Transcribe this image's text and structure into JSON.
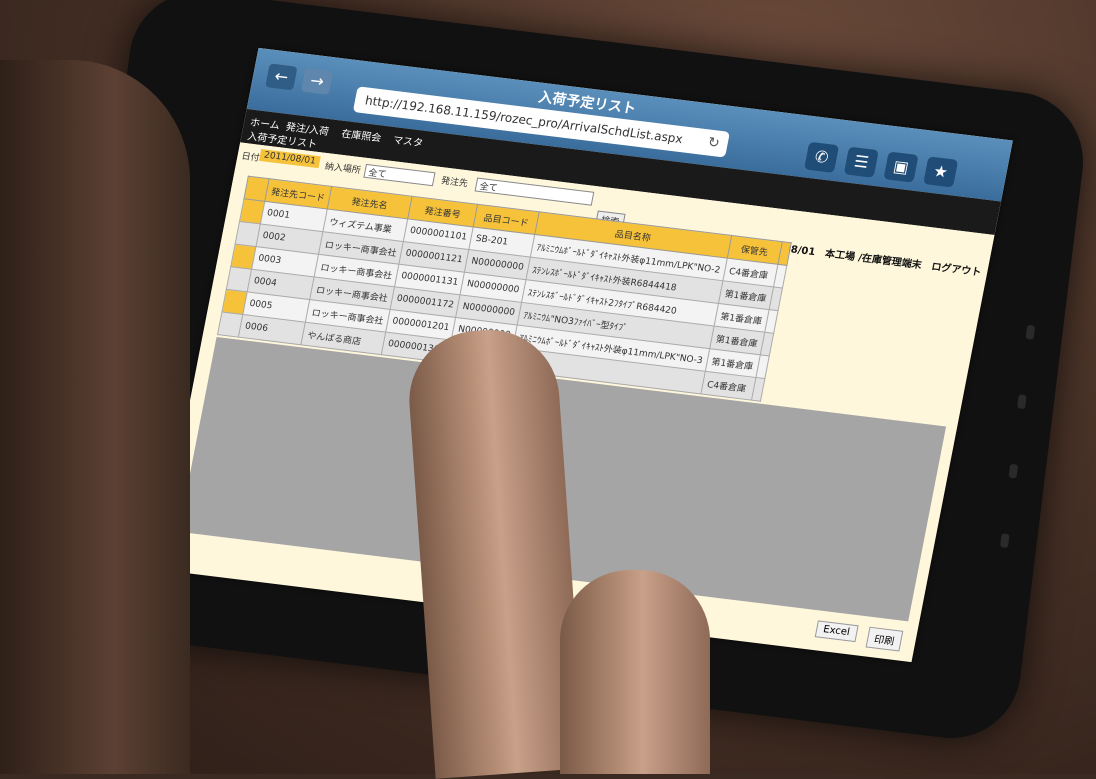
{
  "browser": {
    "title": "入荷予定リスト",
    "url": "http://192.168.11.159/rozec_pro/ArrivalSchdList.aspx",
    "back_icon": "←",
    "forward_icon": "→",
    "refresh_icon": "↻"
  },
  "toolbar": {
    "phone_icon": "✆",
    "memo_icon": "☰",
    "window_icon": "▣",
    "favorite_icon": "★"
  },
  "menu": {
    "items": [
      "ホーム",
      "発注/入荷",
      "在庫照会",
      "マスタ"
    ],
    "current": "入荷予定リスト"
  },
  "filters": {
    "date_label": "日付",
    "date_value": "2011/08/01",
    "warehouse_label": "納入場所",
    "warehouse_value": "全て",
    "supplier_label": "発注先",
    "supplier_value": "全て",
    "search_button": "検索"
  },
  "status": {
    "user_info": "2011/08/01　本工場 /在庫管理端末　ログアウト"
  },
  "table": {
    "headers": [
      "",
      "発注先コード",
      "発注先名",
      "発注番号",
      "品目コード",
      "品目名称",
      "保管先",
      ""
    ],
    "rows": [
      [
        "",
        "0001",
        "ウィズテム事業",
        "0000001101",
        "SB-201",
        "ｱﾙﾐﾆｳﾑﾎﾞｰﾙﾄﾞﾀﾞｲｷｬｽﾄ外装φ11mm/LPK\"NO-2",
        "C4番倉庫"
      ],
      [
        "",
        "0002",
        "ロッキー商事会社",
        "0000001121",
        "N00000000",
        "ｽﾃﾝﾚｽﾎﾞｰﾙﾄﾞﾀﾞｲｷｬｽﾄ外装R6844418",
        "第1番倉庫"
      ],
      [
        "",
        "0003",
        "ロッキー商事会社",
        "0000001131",
        "N00000000",
        "ｽﾃﾝﾚｽﾎﾞｰﾙﾄﾞﾀﾞｲｷｬｽﾄ2ﾌﾀｲﾌﾟR684420",
        "第1番倉庫"
      ],
      [
        "",
        "0004",
        "ロッキー商事会社",
        "0000001172",
        "N00000000",
        "ｱﾙﾐﾆｳﾑ\"NO3ﾌｧｲﾊﾞｰ型ﾀｲﾌﾟ",
        "第1番倉庫"
      ],
      [
        "",
        "0005",
        "ロッキー商事会社",
        "0000001201",
        "N00000000",
        "ｱﾙﾐﾆｳﾑﾎﾞｰﾙﾄﾞﾀﾞｲｷｬｽﾄ外装φ11mm/LPK\"NO-3",
        "第1番倉庫"
      ],
      [
        "",
        "0006",
        "やんばる商店",
        "0000001301",
        "",
        "",
        "C4番倉庫"
      ]
    ]
  },
  "footer": {
    "excel_button": "Excel",
    "print_button": "印刷"
  }
}
